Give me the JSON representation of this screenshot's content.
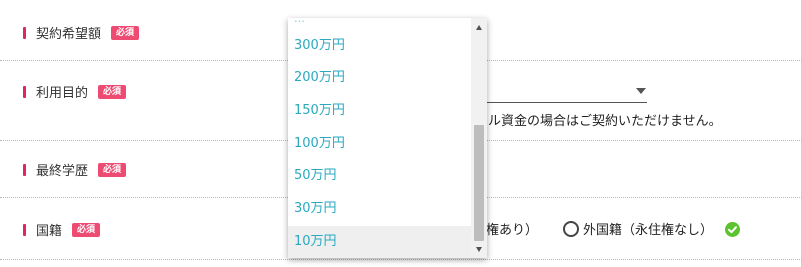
{
  "form": {
    "rows": [
      {
        "label": "契約希望額",
        "badge": "必須"
      },
      {
        "label": "利用目的",
        "badge": "必須"
      },
      {
        "label": "最終学歴",
        "badge": "必須"
      },
      {
        "label": "国籍",
        "badge": "必須"
      }
    ],
    "purpose_notice": "ル資金の場合はご契約いただけません。",
    "nationality": {
      "partial_option_text": "権あり）",
      "option_label": "外国籍（永住権なし）"
    }
  },
  "dropdown": {
    "options": [
      "300万円",
      "200万円",
      "150万円",
      "100万円",
      "50万円",
      "30万円",
      "10万円"
    ],
    "selected_index": 6
  },
  "colors": {
    "required_mark": "#e0245e",
    "badge": "#ee4b73",
    "option_text": "#2aa9c0",
    "check": "#5cc22e"
  }
}
